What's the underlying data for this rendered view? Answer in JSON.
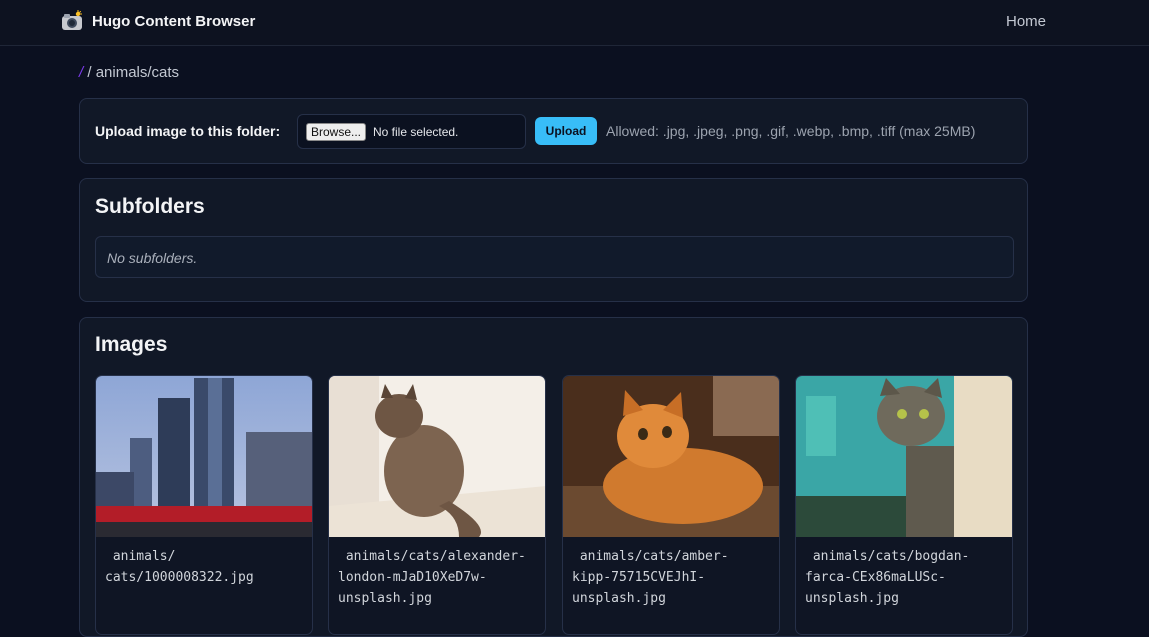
{
  "app": {
    "title": "Hugo Content Browser",
    "icon": "camera-icon",
    "nav": {
      "home_label": "Home"
    }
  },
  "breadcrumb": {
    "root": "/",
    "separator": "/",
    "path": "animals/cats"
  },
  "upload": {
    "label": "Upload image to this folder:",
    "browse_label": "Browse...",
    "file_status": "No file selected.",
    "button_label": "Upload",
    "allowed_text": "Allowed: .jpg, .jpeg, .png, .gif, .webp, .bmp, .tiff (max 25MB)"
  },
  "subfolders": {
    "title": "Subfolders",
    "empty_text": "No subfolders."
  },
  "images": {
    "title": "Images",
    "items": [
      {
        "caption": " animals/\ncats/1000008322.jpg"
      },
      {
        "caption": " animals/cats/alexander-\nlondon-mJaD10XeD7w-\nunsplash.jpg"
      },
      {
        "caption": " animals/cats/amber-\nkipp-75715CVEJhI-\nunsplash.jpg"
      },
      {
        "caption": " animals/cats/bogdan-\nfarca-CEx86maLUSc-\nunsplash.jpg"
      }
    ]
  },
  "colors": {
    "background": "#0b1020",
    "card": "#111827",
    "accent": "#38bdf8",
    "breadcrumb_root": "#7c3aed"
  }
}
